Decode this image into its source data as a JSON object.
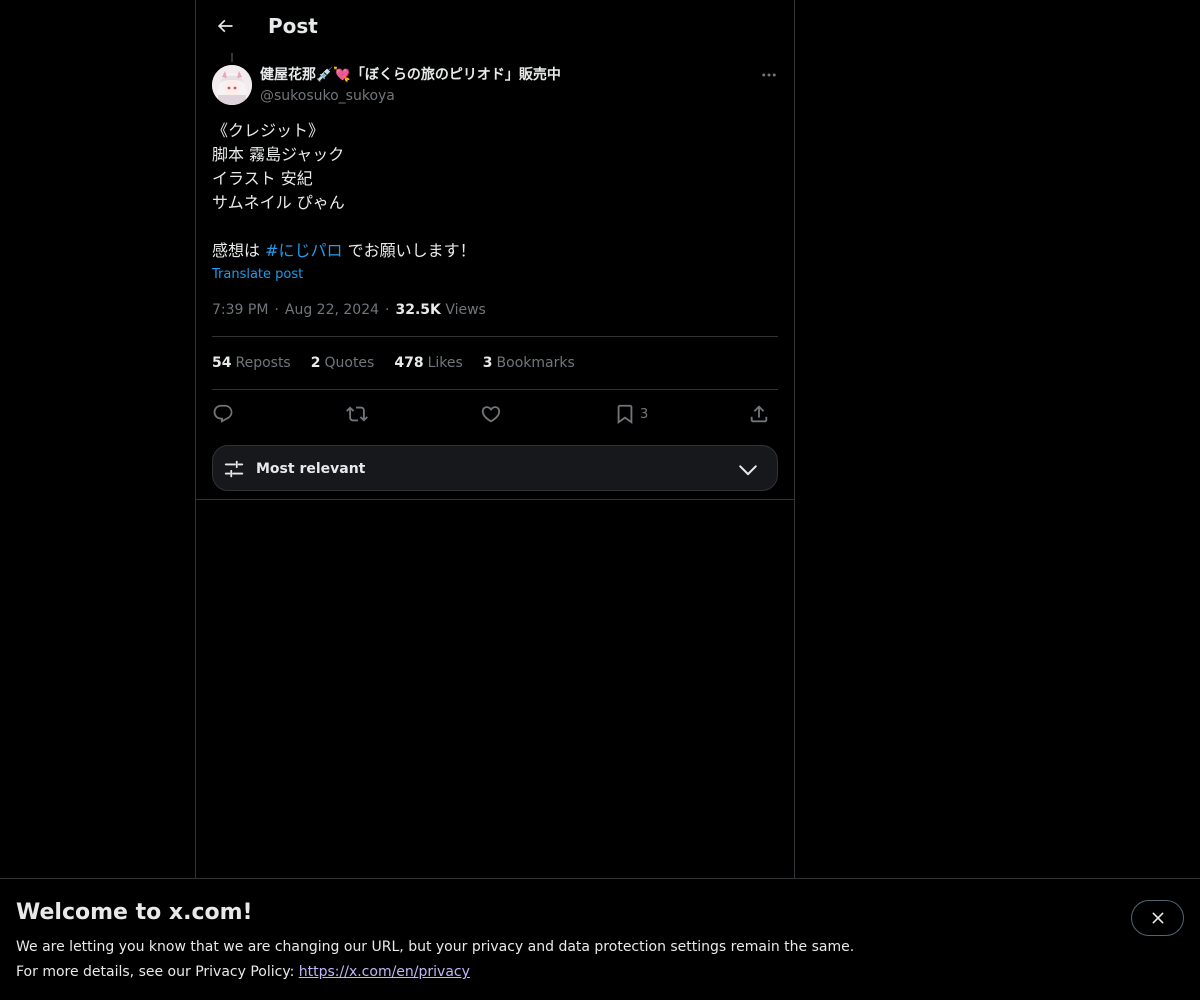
{
  "header": {
    "title": "Post",
    "back_icon": "arrow-left-icon"
  },
  "author": {
    "display_name": "健屋花那💉💘「ぼくらの旅のピリオド」販売中",
    "handle": "@sukosuko_sukoya",
    "more_icon": "more-horizontal-icon"
  },
  "post": {
    "lines": [
      "《クレジット》",
      "脚本 霧島ジャック",
      "イラスト 安紀",
      "サムネイル ぴゃん"
    ],
    "closing_prefix": "感想は ",
    "hashtag": "#にじパロ",
    "closing_suffix": " でお願いします！",
    "translate": "Translate post"
  },
  "meta": {
    "time": "7:39 PM",
    "date": "Aug 22, 2024",
    "views_count": "32.5K",
    "views_label": "Views"
  },
  "stats": {
    "reposts_count": "54",
    "reposts_label": "Reposts",
    "quotes_count": "2",
    "quotes_label": "Quotes",
    "likes_count": "478",
    "likes_label": "Likes",
    "bookmarks_count": "3",
    "bookmarks_label": "Bookmarks"
  },
  "actions": {
    "reply_icon": "reply-icon",
    "repost_icon": "repost-icon",
    "like_icon": "heart-icon",
    "bookmark_icon": "bookmark-icon",
    "bookmark_count": "3",
    "share_icon": "share-icon"
  },
  "sort": {
    "label": "Most relevant",
    "icon": "sliders-icon"
  },
  "banner": {
    "title": "Welcome to x.com!",
    "line1": "We are letting you know that we are changing our URL, but your privacy and data protection settings remain the same.",
    "line2_prefix": "For more details, see our Privacy Policy: ",
    "link": "https://x.com/en/privacy"
  },
  "colors": {
    "background": "#000000",
    "text": "#e7e9ea",
    "muted": "#71767b",
    "accent": "#1d9bf0",
    "border": "#2f3336",
    "link_visited": "#c2b5f4"
  }
}
